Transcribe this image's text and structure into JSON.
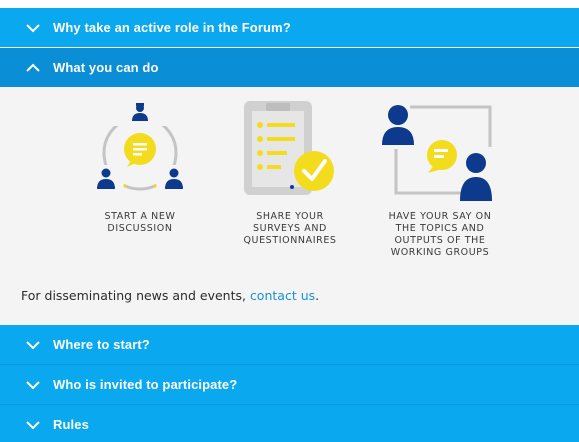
{
  "sections": [
    {
      "label": "Why take an active role in the Forum?",
      "state": "collapsed"
    },
    {
      "label": "What you can do",
      "state": "expanded"
    },
    {
      "label": "Where to start?",
      "state": "collapsed"
    },
    {
      "label": "Who is invited to participate?",
      "state": "collapsed"
    },
    {
      "label": "Rules",
      "state": "collapsed"
    }
  ],
  "what_you_can_do": {
    "features": [
      {
        "caption": "START A NEW\nDISCUSSION",
        "icon": "discussion-icon"
      },
      {
        "caption": "SHARE YOUR\nSURVEYS AND\nQUESTIONNAIRES",
        "icon": "survey-checklist-icon"
      },
      {
        "caption": "HAVE YOUR SAY ON\nTHE TOPICS AND\nOUTPUTS OF THE\nWORKING GROUPS",
        "icon": "people-conversation-icon"
      }
    ],
    "footnote_text": "For disseminating news and events, ",
    "footnote_link": "contact us",
    "footnote_end": "."
  },
  "colors": {
    "header": "#0aa8ee",
    "header_open": "#0a8fd6",
    "panel_bg": "#f4f4f4",
    "navy": "#0d3a8c",
    "yellow": "#f3dc1e",
    "gray": "#c4c4c4",
    "link": "#1a8fd8"
  }
}
